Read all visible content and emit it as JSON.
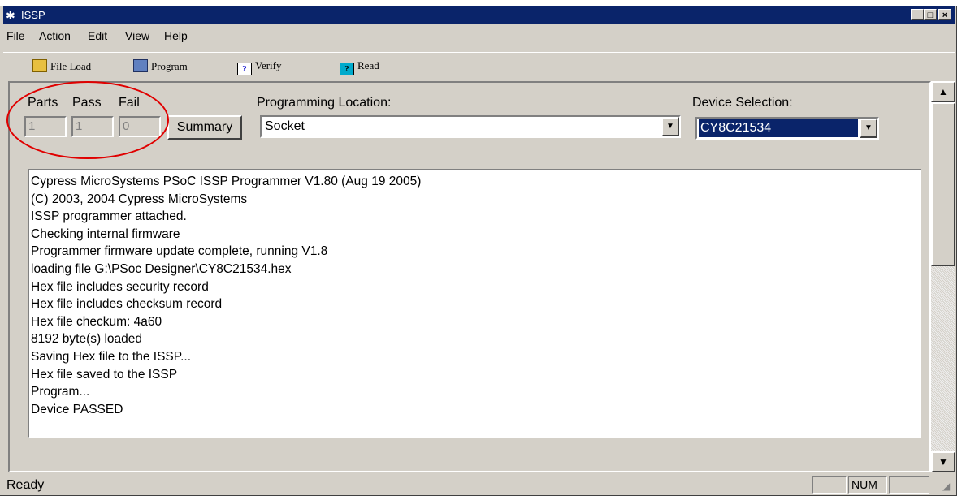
{
  "window": {
    "title": "ISSP",
    "controls": [
      "_",
      "□",
      "x"
    ]
  },
  "menu": [
    {
      "label": "File",
      "u": "F",
      "rest": "ile"
    },
    {
      "label": "Action",
      "u": "A",
      "rest": "ction"
    },
    {
      "label": "Edit",
      "u": "E",
      "rest": "dit"
    },
    {
      "label": "View",
      "u": "V",
      "rest": "iew"
    },
    {
      "label": "Help",
      "u": "H",
      "rest": "elp"
    }
  ],
  "toolbar": {
    "file_load": "File Load",
    "program": "Program",
    "verify": "Verify",
    "read": "Read"
  },
  "counters": {
    "parts_label": "Parts",
    "pass_label": "Pass",
    "fail_label": "Fail",
    "parts_value": "1",
    "pass_value": "1",
    "fail_value": "0",
    "summary_button": "Summary"
  },
  "programming_location": {
    "label": "Programming Location:",
    "value": "Socket"
  },
  "device_selection": {
    "label": "Device Selection:",
    "value": "CY8C21534"
  },
  "log": [
    "Cypress MicroSystems PSoC ISSP Programmer V1.80 (Aug 19 2005)",
    "(C) 2003, 2004 Cypress MicroSystems",
    "ISSP programmer attached.",
    "Checking internal firmware",
    "Programmer firmware update complete, running V1.8",
    "loading file G:\\PSoc Designer\\CY8C21534.hex",
    "Hex file includes security record",
    "Hex file includes checksum record",
    "Hex file checkum: 4a60",
    "8192 byte(s) loaded",
    "Saving Hex file to the ISSP...",
    "Hex file saved to the ISSP",
    "Program...",
    "Device PASSED"
  ],
  "status": {
    "text": "Ready",
    "num": "NUM"
  },
  "annotation_color": "#e00000"
}
